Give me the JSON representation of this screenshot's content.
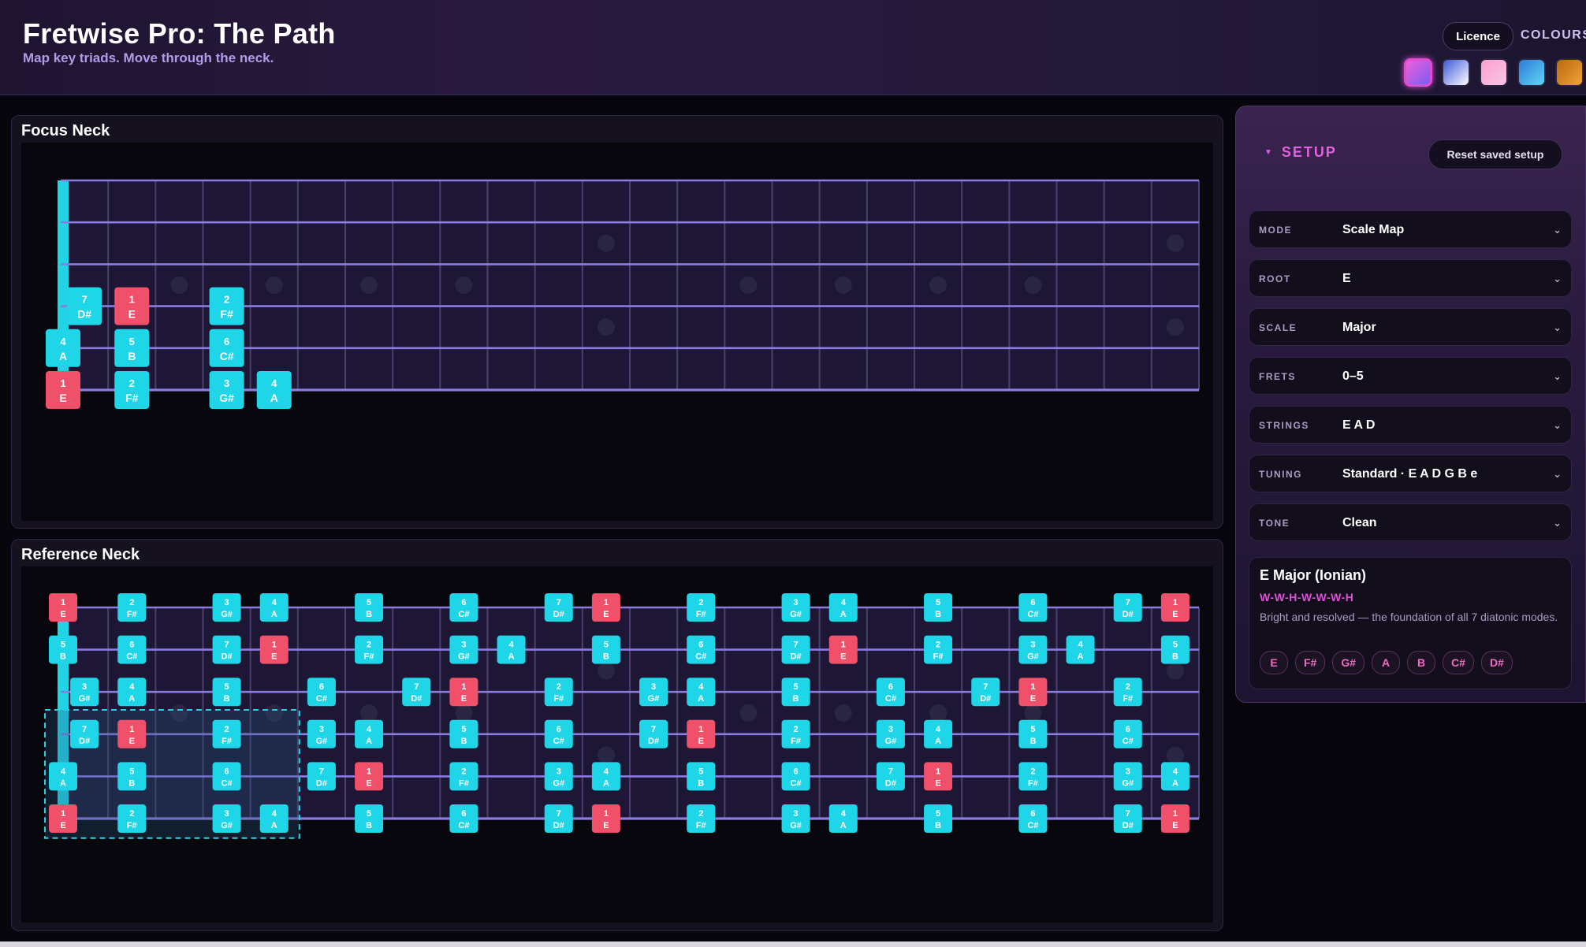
{
  "app": {
    "title": "Fretwise Pro: The Path",
    "subtitle": "Map key triads. Move through the neck."
  },
  "header": {
    "licence_label": "Licence",
    "colours_label": "COLOURS",
    "swatches": [
      {
        "name": "magenta-cyan",
        "gradient": [
          "#f060d8",
          "#7a5cf5"
        ],
        "active": true
      },
      {
        "name": "blue-white",
        "gradient": [
          "#3b57d6",
          "#ffffff"
        ],
        "active": false
      },
      {
        "name": "pink",
        "gradient": [
          "#ff9fcf",
          "#f7c6e6"
        ],
        "active": false
      },
      {
        "name": "sky",
        "gradient": [
          "#2e7bd8",
          "#5fd6f5"
        ],
        "active": false
      },
      {
        "name": "amber",
        "gradient": [
          "#b86a10",
          "#f0a238"
        ],
        "active": false
      }
    ]
  },
  "focus_neck": {
    "title": "Focus Neck"
  },
  "reference_neck": {
    "title": "Reference Neck"
  },
  "setup": {
    "title": "SETUP",
    "reset_label": "Reset saved setup",
    "settings": [
      {
        "label": "MODE",
        "value": "Scale Map"
      },
      {
        "label": "ROOT",
        "value": "E"
      },
      {
        "label": "SCALE",
        "value": "Major"
      },
      {
        "label": "FRETS",
        "value": "0–5"
      },
      {
        "label": "STRINGS",
        "value": "E A D"
      },
      {
        "label": "TUNING",
        "value": "Standard · E A D G B e"
      },
      {
        "label": "TONE",
        "value": "Clean"
      }
    ],
    "info": {
      "title": "E Major (Ionian)",
      "formula": "W-W-H-W-W-W-H",
      "description": "Bright and resolved — the foundation of all 7 diatonic modes.",
      "notes": [
        "E",
        "F#",
        "G#",
        "A",
        "B",
        "C#",
        "D#"
      ]
    }
  },
  "colors": {
    "root_note": "#f0506a",
    "scale_note": "#1fd6e8",
    "nut": "#22d3e6",
    "string": "#8c7be0",
    "fret_wire": "#4a3f6e",
    "accent": "#e24fd8"
  },
  "fretboard": {
    "fret_count": 24,
    "tuning_low_to_high": [
      "E",
      "A",
      "D",
      "G",
      "B",
      "E"
    ],
    "root": "E",
    "scale_notes": [
      "E",
      "F#",
      "G#",
      "A",
      "B",
      "C#",
      "D#"
    ],
    "inlays": [
      3,
      5,
      7,
      9,
      15,
      17,
      19,
      21
    ],
    "double_inlays": [
      12,
      24
    ],
    "focus_strings": [
      0,
      1,
      2
    ],
    "focus_fret_range": [
      0,
      5
    ],
    "reference_highlight_fret_range": [
      0,
      5
    ],
    "reference_highlight_strings": [
      0,
      1,
      2
    ]
  }
}
